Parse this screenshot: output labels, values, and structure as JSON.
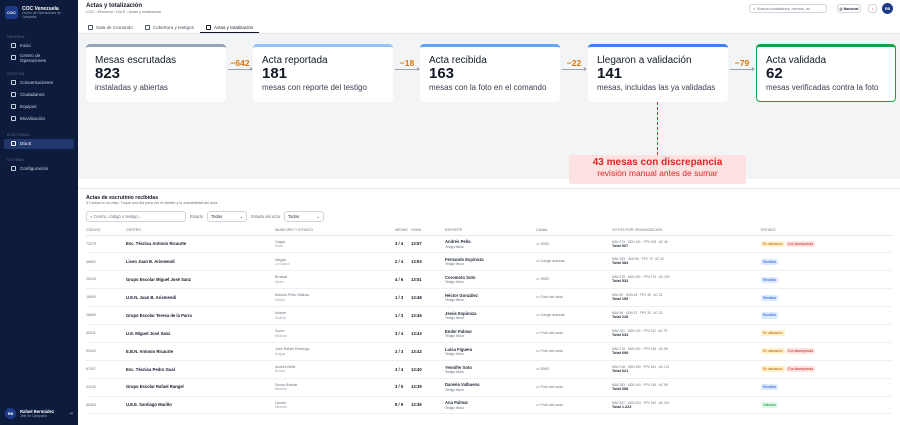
{
  "brand": {
    "name": "COC Venezuela",
    "sub1": "Centro de Operaciones de",
    "sub2": "Campaña",
    "logo": "COC"
  },
  "nav": {
    "sections": [
      {
        "title": "GENERAL",
        "items": [
          {
            "label": "Inicio",
            "icon": "home-icon"
          },
          {
            "label": "Centro de Operaciones",
            "icon": "grid-icon"
          }
        ]
      },
      {
        "title": "GESTIÓN",
        "items": [
          {
            "label": "Conversaciones",
            "icon": "chat-icon"
          },
          {
            "label": "Ciudadanos",
            "icon": "users-icon"
          },
          {
            "label": "Equipos",
            "icon": "team-icon"
          },
          {
            "label": "Movilización",
            "icon": "route-icon"
          }
        ]
      },
      {
        "title": "ELECTORAL",
        "items": [
          {
            "label": "Día E",
            "icon": "calendar-icon",
            "active": true
          }
        ]
      },
      {
        "title": "SISTEMA",
        "items": [
          {
            "label": "Configuración",
            "icon": "gear-icon"
          }
        ]
      }
    ]
  },
  "user": {
    "initials": "RB",
    "name": "Rafael Bermúdez",
    "role": "Jefe de Campaña"
  },
  "header": {
    "title": "Actas y totalización",
    "breadcrumb": "COC › Electoral › Día E › Actas y totalización",
    "search_placeholder": "Buscar ciudadanos, centros, ac",
    "scope": "Nacional",
    "avatar": "RB"
  },
  "tabs": [
    {
      "label": "Sala de Comando"
    },
    {
      "label": "Cobertura y testigos"
    },
    {
      "label": "Actas y totalización",
      "active": true
    }
  ],
  "funnel": {
    "cards": [
      {
        "title": "Mesas escrutadas",
        "value": "823",
        "sub": "instaladas y abiertas",
        "color": "#93a3b8"
      },
      {
        "title": "Acta reportada",
        "value": "181",
        "sub": "mesas con reporte del testigo",
        "color": "#93c5fd"
      },
      {
        "title": "Acta recibida",
        "value": "163",
        "sub": "mesas con la foto en el comando",
        "color": "#60a5fa"
      },
      {
        "title": "Llegaron a validación",
        "value": "141",
        "sub": "mesas, incluidas las ya validadas",
        "color": "#3b82f6"
      },
      {
        "title": "Acta validada",
        "value": "62",
        "sub": "mesas verificadas contra la foto",
        "color": "#16a34a"
      }
    ],
    "drops": [
      "−642",
      "−18",
      "−22",
      "−79"
    ],
    "discrepancy": {
      "title": "43 mesas con discrepancia",
      "sub": "revisión manual antes de sumar"
    }
  },
  "panel": {
    "title": "Actas de escrutinio recibidas",
    "subtitle": "37 actas en la vista. Toque una fila para ver el detalle y la trazabilidad del acta.",
    "search_placeholder": "Centro, código o testigo...",
    "estado_label": "Estado",
    "estado_value": "Todos",
    "estado_acta_label": "Estado del acta",
    "estado_acta_value": "Todos",
    "columns": [
      "CÓDIGO",
      "CENTRO",
      "MUNICIPIO Y ESTADO",
      "MESAS",
      "HORA",
      "REPORTE",
      "CANAL",
      "VOTOS POR ORGANIZACIÓN",
      "ESTADO"
    ],
    "rows": [
      {
        "code": "72379",
        "centro": "Esc. Técnica Antonio Ricaurte",
        "mun": "Caigui",
        "est": "Sucre",
        "mesas": "3 / 4",
        "hora": "13:57",
        "rep": "Andrés Peña",
        "rol": "Testigo titular",
        "canal": "SMS",
        "canal_icon": "sms-icon",
        "votos": "MAV 273 · UDN 141 · FPV 108 · AC 46",
        "total": "Total 567",
        "badges": [
          {
            "t": "En validación",
            "c": "rev"
          },
          {
            "t": "Con discrepancia",
            "c": "disc"
          }
        ]
      },
      {
        "code": "46661",
        "centro": "Liceo Juan B. Arismendi",
        "mun": "Vargas",
        "est": "La Guaira",
        "mesas": "2 / 4",
        "hora": "13:53",
        "rep": "Fernando Espinoza",
        "rol": "Testigo titular",
        "canal": "Carga manual",
        "canal_icon": "edit-icon",
        "votos": "MAV 183 · UDN 96 · FPV 73 · AC 32",
        "total": "Total 384",
        "badges": [
          {
            "t": "Recibida",
            "c": "rec"
          }
        ]
      },
      {
        "code": "28443",
        "centro": "Grupo Escolar Miguel José Sanz",
        "mun": "Brusual",
        "est": "Apure",
        "mesas": "4 / 6",
        "hora": "13:51",
        "rep": "Coromoto Soto",
        "rol": "Testigo titular",
        "canal": "SMS",
        "canal_icon": "sms-icon",
        "votos": "MAV 278 · UDN 151 · FPV 175 · AC 129",
        "total": "Total 533",
        "badges": [
          {
            "t": "Recibida",
            "c": "rec"
          }
        ]
      },
      {
        "code": "16609",
        "centro": "U.E.N. Juan B. Arismendi",
        "mun": "Antonio Pinto Salinas",
        "est": "Mérida",
        "mesas": "1 / 3",
        "hora": "13:48",
        "rep": "Héctor González",
        "rol": "Testigo titular",
        "canal": "Foto del acta",
        "canal_icon": "camera-icon",
        "votos": "MAV 82 · UDN 44 · FPV 35 · AC 23",
        "total": "Total 159",
        "badges": [
          {
            "t": "Recibida",
            "c": "rec"
          }
        ]
      },
      {
        "code": "28669",
        "centro": "Grupo Escolar Teresa de la Parra",
        "mun": "Infante",
        "est": "Guárico",
        "mesas": "1 / 3",
        "hora": "13:45",
        "rep": "Jesús Espinoza",
        "rol": "Testigo titular",
        "canal": "Carga manual",
        "canal_icon": "edit-icon",
        "votos": "MAV 98 · UDN 57 · FPV 33 · AC 23",
        "total": "Total 228",
        "badges": [
          {
            "t": "Recibida",
            "c": "rec"
          }
        ]
      },
      {
        "code": "40311",
        "centro": "U.E. Miguel José Sanz",
        "mun": "Sucre",
        "est": "Miranda",
        "mesas": "3 / 4",
        "hora": "13:43",
        "rep": "Ender Palmar",
        "rol": "Testigo titular",
        "canal": "Foto del acta",
        "canal_icon": "camera-icon",
        "votos": "MAV 281 · UDN 131 · FPV 112 · AC 79",
        "total": "Total 633",
        "badges": [
          {
            "t": "En validación",
            "c": "rev"
          }
        ]
      },
      {
        "code": "93422",
        "centro": "E.B.N. Antonio Ricaurte",
        "mun": "José Rafael Revenga",
        "est": "Aragua",
        "mesas": "2 / 3",
        "hora": "13:42",
        "rep": "Luisa Figuera",
        "rol": "Testigo titular",
        "canal": "Foto del acta",
        "canal_icon": "camera-icon",
        "votos": "MAV 278 · UDN 201 · FPV 126 · AC 98",
        "total": "Total 698",
        "badges": [
          {
            "t": "En validación",
            "c": "rev"
          },
          {
            "t": "Con discrepancia",
            "c": "disc"
          }
        ]
      },
      {
        "code": "67437",
        "centro": "Esc. Técnica Pedro Gual",
        "mun": "Andrés Bello",
        "est": "Bolívar",
        "mesas": "3 / 4",
        "hora": "13:40",
        "rep": "Yennifer Soto",
        "rol": "Testigo titular",
        "canal": "SMS",
        "canal_icon": "sms-icon",
        "votos": "MAV 218 · UDN 159 · FPV 161 · AC 121",
        "total": "Total 621",
        "badges": [
          {
            "t": "En validación",
            "c": "rev"
          },
          {
            "t": "Con discrepancia",
            "c": "disc"
          }
        ]
      },
      {
        "code": "41153",
        "centro": "Grupo Escolar Rafael Rangel",
        "mun": "Simón Bolívar",
        "est": "Miranda",
        "mesas": "3 / 5",
        "hora": "13:39",
        "rep": "Daniela Valbuena",
        "rol": "Testigo titular",
        "canal": "Foto del acta",
        "canal_icon": "camera-icon",
        "votos": "MAV 283 · UDN 143 · FPV 136 · AC 98",
        "total": "Total 658",
        "badges": [
          {
            "t": "Recibida",
            "c": "rec"
          }
        ]
      },
      {
        "code": "86363",
        "centro": "U.E.E. Santiago Mariño",
        "mun": "Lander",
        "est": "Miranda",
        "mesas": "8 / 9",
        "hora": "13:36",
        "rep": "Ana Palmar",
        "rol": "Testigo titular",
        "canal": "Foto del acta",
        "canal_icon": "camera-icon",
        "votos": "MAV 537 · UDN 233 · FPV 244 · AC 167",
        "total": "Total 1.223",
        "badges": [
          {
            "t": "Validada",
            "c": "val"
          }
        ]
      }
    ]
  }
}
